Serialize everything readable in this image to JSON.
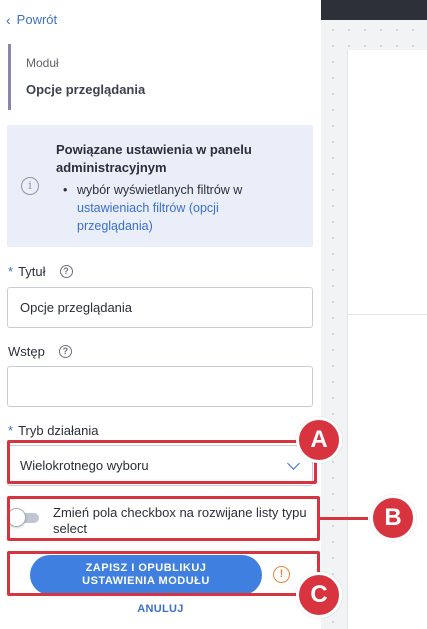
{
  "nav": {
    "back_label": "Powrót"
  },
  "module": {
    "kicker": "Moduł",
    "name": "Opcje przeglądania"
  },
  "info": {
    "title": "Powiązane ustawienia w panelu administracyjnym",
    "item_prefix": "wybór wyświetlanych filtrów w",
    "item_link": "ustawieniach filtrów (opcji przeglądania)"
  },
  "fields": {
    "title": {
      "label": "Tytuł",
      "value": "Opcje przeglądania"
    },
    "intro": {
      "label": "Wstęp",
      "value": ""
    },
    "mode": {
      "label": "Tryb działania",
      "selected": "Wielokrotnego wyboru"
    }
  },
  "toggle": {
    "label": "Zmień pola checkbox na rozwijane listy typu select",
    "on": false
  },
  "actions": {
    "save_line1": "ZAPISZ I OPUBLIKUJ",
    "save_line2": "USTAWIENIA MODUŁU",
    "cancel": "ANULUJ"
  },
  "callouts": [
    "A",
    "B",
    "C"
  ],
  "colors": {
    "accent": "#3f7fe0",
    "link": "#3b6fcf",
    "callout": "#d8343f",
    "warning": "#e8873f"
  }
}
